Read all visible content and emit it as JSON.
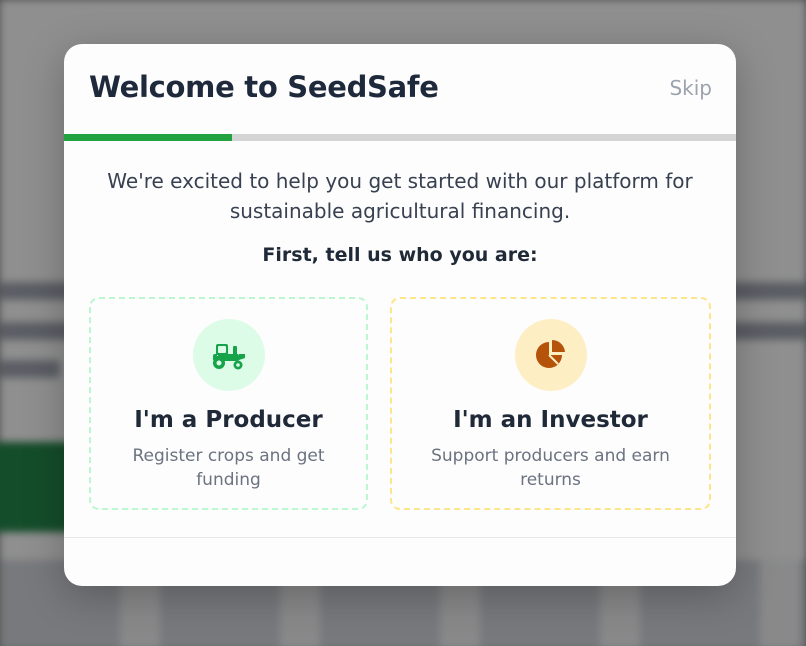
{
  "modal": {
    "title": "Welcome to SeedSafe",
    "skip_label": "Skip",
    "progress_fraction": 0.25,
    "intro_line1": "We're excited to help you get started with our platform for",
    "intro_line2": "sustainable agricultural financing.",
    "prompt": "First, tell us who you are:"
  },
  "roles": [
    {
      "title": "I'm a Producer",
      "description": "Register crops and get funding",
      "icon": "tractor-icon",
      "accent": "#16a34a"
    },
    {
      "title": "I'm an Investor",
      "description": "Support producers and earn returns",
      "icon": "pie-chart-icon",
      "accent": "#b45309"
    }
  ],
  "colors": {
    "brand_green": "#22a33f",
    "title_text": "#1e293b",
    "muted_text": "#6b7280"
  }
}
